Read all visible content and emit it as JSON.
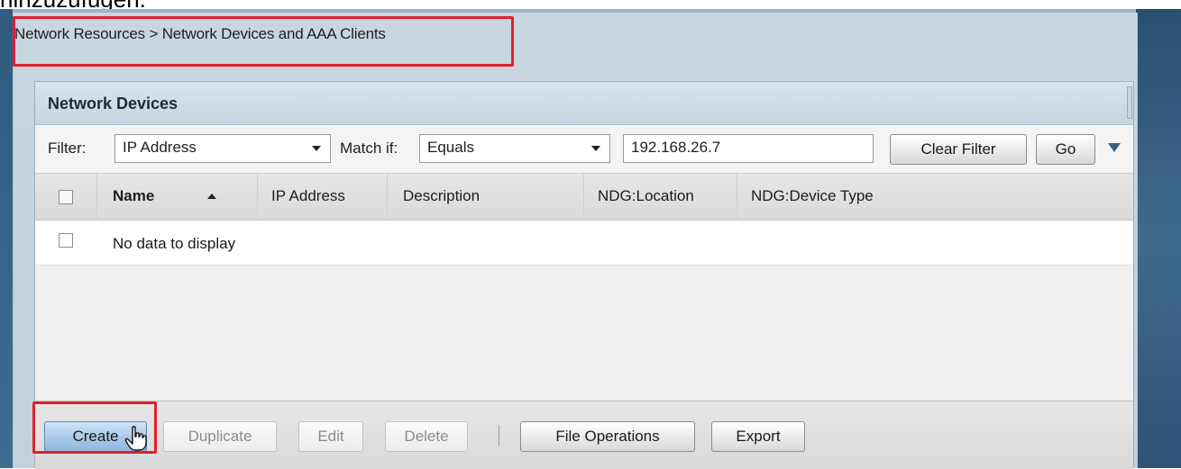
{
  "caption": "hinzuzufügen.",
  "breadcrumb": "Network Resources > Network Devices and AAA Clients",
  "panel": {
    "title": "Network Devices"
  },
  "filter": {
    "filter_label": "Filter:",
    "filter_field_value": "IP Address",
    "match_label": "Match if:",
    "match_value": "Equals",
    "filter_text_value": "192.168.26.7",
    "clear_filter_label": "Clear Filter",
    "go_label": "Go"
  },
  "table": {
    "columns": [
      "Name",
      "IP Address",
      "Description",
      "NDG:Location",
      "NDG:Device Type"
    ],
    "sorted_column": "Name",
    "sort_direction": "ascending",
    "empty_message": "No data to display"
  },
  "toolbar": {
    "create_label": "Create",
    "duplicate_label": "Duplicate",
    "edit_label": "Edit",
    "delete_label": "Delete",
    "file_operations_label": "File Operations",
    "export_label": "Export"
  },
  "colors": {
    "highlight_box": "#e0202a",
    "primary_button": "#a9c9ea"
  }
}
